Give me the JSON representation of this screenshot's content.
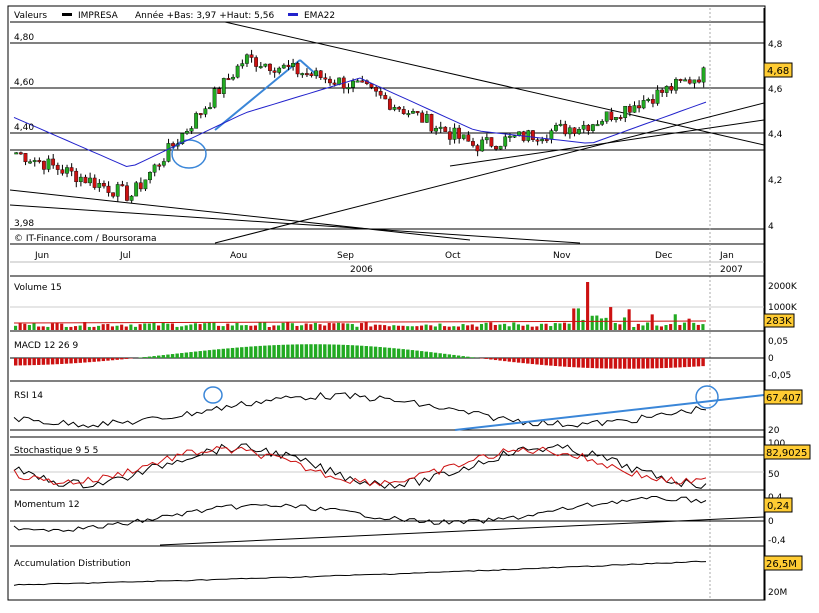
{
  "colors": {
    "up": "#22aa22",
    "down": "#cc1111",
    "ema": "#2222cc",
    "trend": "#3a86d8",
    "badge": "#ffcc33",
    "frame": "#000000"
  },
  "main": {
    "label_valeurs": "Valeurs",
    "label_name": "IMPRESA",
    "label_stats": "Année +Bas: 3,97 +Haut: 5,56",
    "label_ema": "EMA22",
    "credit": "© IT-Finance.com / Boursorama",
    "badge": "4,68",
    "left_ticks": [
      "4,80",
      "4,60",
      "4,40",
      "3,98"
    ],
    "right_ticks": [
      "4,8",
      "4,6",
      "4,4",
      "4,2",
      "4"
    ]
  },
  "x_axis": {
    "months": [
      "Jun",
      "Jul",
      "Aou",
      "Sep",
      "Oct",
      "Nov",
      "Dec",
      "Jan"
    ],
    "year_2006": "2006",
    "year_2007": "2007"
  },
  "volume": {
    "title": "Volume 15",
    "ticks": [
      "2000K",
      "1000K"
    ],
    "badge": "283K"
  },
  "macd": {
    "title": "MACD 12 26 9",
    "ticks": [
      "0,05",
      "0",
      "-0,05"
    ]
  },
  "rsi": {
    "title": "RSI 14",
    "ticks": [
      "20"
    ],
    "badge": "67,407"
  },
  "stoch": {
    "title": "Stochastique 9 5 5",
    "ticks": [
      "100",
      "50"
    ],
    "badge": "82,9025"
  },
  "momentum": {
    "title": "Momentum 12",
    "ticks": [
      "0,4",
      "0",
      "-0,4"
    ],
    "badge": "0,24"
  },
  "accum": {
    "title": "Accumulation Distribution",
    "ticks": [
      "20M"
    ],
    "badge": "26,5M"
  },
  "chart_data": {
    "type": "line",
    "title": "IMPRESA",
    "series": [
      {
        "name": "IMPRESA",
        "x": [
          "2006-06",
          "2006-07",
          "2006-08",
          "2006-09",
          "2006-10",
          "2006-11",
          "2006-12"
        ],
        "y": [
          4.32,
          4.12,
          4.75,
          4.62,
          4.35,
          4.45,
          4.68
        ]
      },
      {
        "name": "EMA22",
        "x": [
          "2006-06",
          "2006-07",
          "2006-08",
          "2006-09",
          "2006-10",
          "2006-11",
          "2006-12"
        ],
        "y": [
          4.48,
          4.25,
          4.5,
          4.66,
          4.42,
          4.36,
          4.55
        ]
      }
    ],
    "ylim": [
      3.96,
      4.88
    ],
    "grid": true,
    "legend": "top-left"
  }
}
